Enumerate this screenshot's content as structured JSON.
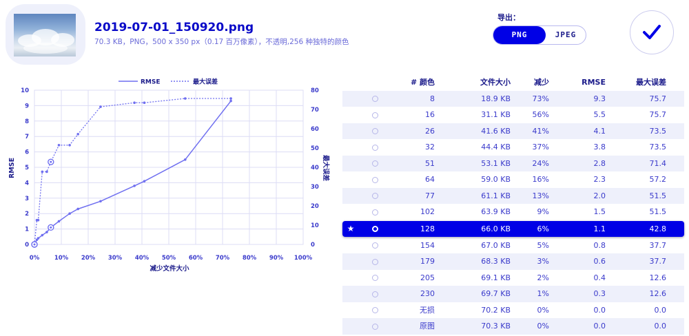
{
  "header": {
    "file_name": "2019-07-01_150920.png",
    "file_meta": "70.3 KB，PNG，500 x 350 px（0.17 百万像素），不透明,256 种独特的颜色",
    "export_label": "导出：",
    "formats": [
      "PNG",
      "JPEG"
    ],
    "selected_format": "PNG"
  },
  "chart_data": {
    "type": "line",
    "legend": [
      "RMSE",
      "最大误差"
    ],
    "legend_position": "top-center",
    "xlabel": "减少文件大小",
    "ylabel_left": "RMSE",
    "ylabel_right": "最大误差",
    "x_ticks": [
      "0%",
      "10%",
      "20%",
      "30%",
      "40%",
      "50%",
      "60%",
      "70%",
      "80%",
      "90%",
      "100%"
    ],
    "y_left_ticks": [
      "0",
      "1",
      "2",
      "3",
      "4",
      "5",
      "6",
      "7",
      "8",
      "9",
      "10"
    ],
    "y_right_ticks": [
      "0",
      "10",
      "20",
      "30",
      "40",
      "50",
      "60",
      "70",
      "80"
    ],
    "xlim": [
      0,
      100
    ],
    "ylim_left": [
      0,
      10
    ],
    "ylim_right": [
      0,
      80
    ],
    "grid": true,
    "series": [
      {
        "name": "RMSE",
        "style": "solid",
        "points": [
          [
            0,
            0
          ],
          [
            0.9,
            0.3
          ],
          [
            1.4,
            0.4
          ],
          [
            2.9,
            0.6
          ],
          [
            4.6,
            0.8
          ],
          [
            6.1,
            1.1
          ],
          [
            9.1,
            1.5
          ],
          [
            13.1,
            2.0
          ],
          [
            16.2,
            2.3
          ],
          [
            24.6,
            2.8
          ],
          [
            37.2,
            3.8
          ],
          [
            40.9,
            4.1
          ],
          [
            56.1,
            5.5
          ],
          [
            73.1,
            9.3
          ]
        ]
      },
      {
        "name": "最大误差",
        "style": "dotted",
        "points": [
          [
            0,
            0
          ],
          [
            0.9,
            12.6
          ],
          [
            1.4,
            12.6
          ],
          [
            2.9,
            37.7
          ],
          [
            4.6,
            37.7
          ],
          [
            6.1,
            42.8
          ],
          [
            9.1,
            51.5
          ],
          [
            13.1,
            51.5
          ],
          [
            16.2,
            57.2
          ],
          [
            24.6,
            71.4
          ],
          [
            37.2,
            73.5
          ],
          [
            40.9,
            73.5
          ],
          [
            56.1,
            75.7
          ],
          [
            73.1,
            75.7
          ]
        ]
      }
    ],
    "highlighted_x": 6.1
  },
  "table": {
    "headers": [
      "# 颜色",
      "文件大小",
      "减少",
      "RMSE",
      "最大误差"
    ],
    "selected_marker": "★",
    "rows": [
      {
        "colors": "8",
        "size": "18.9 KB",
        "reduce": "73%",
        "rmse": "9.3",
        "maxerr": "75.7",
        "selected": false
      },
      {
        "colors": "16",
        "size": "31.1 KB",
        "reduce": "56%",
        "rmse": "5.5",
        "maxerr": "75.7",
        "selected": false
      },
      {
        "colors": "26",
        "size": "41.6 KB",
        "reduce": "41%",
        "rmse": "4.1",
        "maxerr": "73.5",
        "selected": false
      },
      {
        "colors": "32",
        "size": "44.4 KB",
        "reduce": "37%",
        "rmse": "3.8",
        "maxerr": "73.5",
        "selected": false
      },
      {
        "colors": "51",
        "size": "53.1 KB",
        "reduce": "24%",
        "rmse": "2.8",
        "maxerr": "71.4",
        "selected": false
      },
      {
        "colors": "64",
        "size": "59.0 KB",
        "reduce": "16%",
        "rmse": "2.3",
        "maxerr": "57.2",
        "selected": false
      },
      {
        "colors": "77",
        "size": "61.1 KB",
        "reduce": "13%",
        "rmse": "2.0",
        "maxerr": "51.5",
        "selected": false
      },
      {
        "colors": "102",
        "size": "63.9 KB",
        "reduce": "9%",
        "rmse": "1.5",
        "maxerr": "51.5",
        "selected": false
      },
      {
        "colors": "128",
        "size": "66.0 KB",
        "reduce": "6%",
        "rmse": "1.1",
        "maxerr": "42.8",
        "selected": true
      },
      {
        "colors": "154",
        "size": "67.0 KB",
        "reduce": "5%",
        "rmse": "0.8",
        "maxerr": "37.7",
        "selected": false
      },
      {
        "colors": "179",
        "size": "68.3 KB",
        "reduce": "3%",
        "rmse": "0.6",
        "maxerr": "37.7",
        "selected": false
      },
      {
        "colors": "205",
        "size": "69.1 KB",
        "reduce": "2%",
        "rmse": "0.4",
        "maxerr": "12.6",
        "selected": false
      },
      {
        "colors": "230",
        "size": "69.7 KB",
        "reduce": "1%",
        "rmse": "0.3",
        "maxerr": "12.6",
        "selected": false
      },
      {
        "colors": "无损",
        "size": "70.2 KB",
        "reduce": "0%",
        "rmse": "0.0",
        "maxerr": "0.0",
        "selected": false
      },
      {
        "colors": "原图",
        "size": "70.3 KB",
        "reduce": "0%",
        "rmse": "0.0",
        "maxerr": "0.0",
        "selected": false
      }
    ]
  },
  "colors": {
    "accent": "#0000e6",
    "text": "#1a1ad6",
    "row_stripe": "#eef0fb",
    "chart_line": "#6f6ff0",
    "grid": "#dcdcf5"
  },
  "icons": {
    "confirm": "checkmark-icon",
    "row_select": "radio-icon",
    "selected_row": "star-icon"
  }
}
